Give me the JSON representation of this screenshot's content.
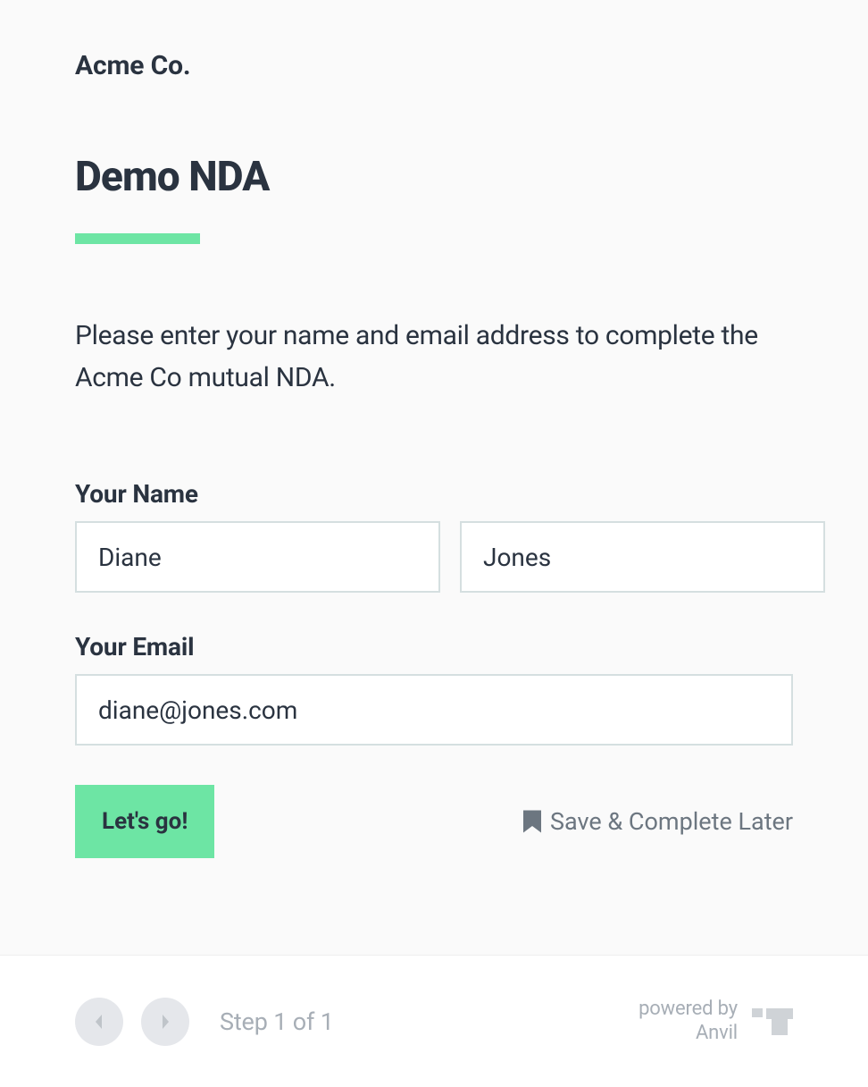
{
  "header": {
    "company": "Acme Co."
  },
  "page": {
    "title": "Demo NDA",
    "instructions": "Please enter your name and email address to complete the Acme Co mutual NDA."
  },
  "form": {
    "name_label": "Your Name",
    "first_name_value": "Diane",
    "last_name_value": "Jones",
    "email_label": "Your Email",
    "email_value": "diane@jones.com",
    "submit_label": "Let's go!",
    "save_later_label": "Save & Complete Later"
  },
  "footer": {
    "step_text": "Step 1 of 1",
    "powered_by_line1": "powered by",
    "powered_by_line2": "Anvil"
  },
  "colors": {
    "accent": "#6de5a4",
    "text_primary": "#2a3340",
    "text_muted": "#6c7680"
  }
}
